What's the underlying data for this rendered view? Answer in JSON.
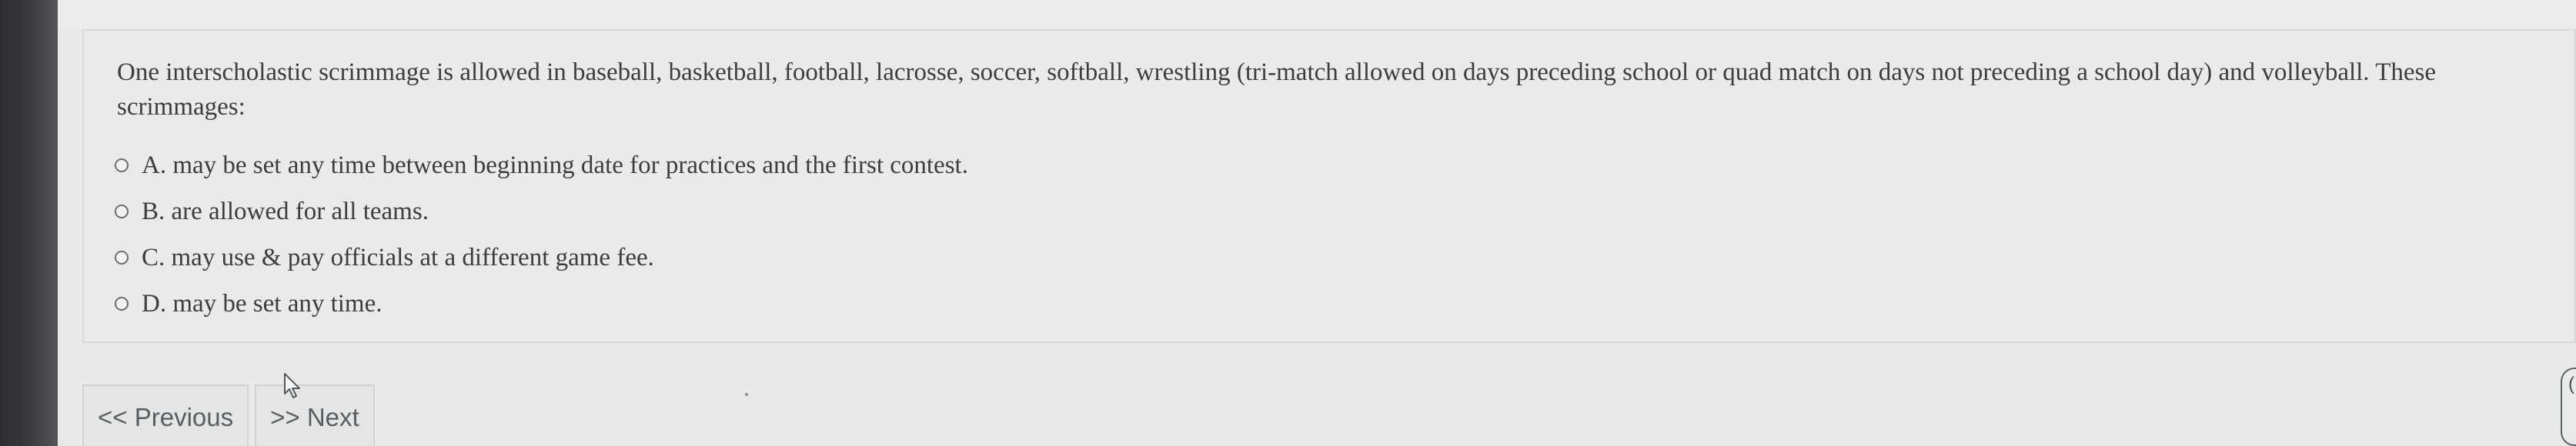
{
  "question": {
    "text": "One interscholastic scrimmage is allowed in baseball, basketball, football, lacrosse, soccer, softball, wrestling (tri-match allowed on days preceding school or quad match on days not preceding a school day) and volleyball. These scrimmages:",
    "options": [
      {
        "label": "A. may be set any time between beginning date for practices and the first contest."
      },
      {
        "label": "B. are allowed for all teams."
      },
      {
        "label": "C. may use & pay officials at a different game fee."
      },
      {
        "label": "D. may be set any time."
      }
    ]
  },
  "nav": {
    "previous_label": "<< Previous",
    "next_label": ">> Next"
  },
  "edge": {
    "glyph": "("
  },
  "icons": {
    "radio": "radio-button-icon",
    "cursor": "mouse-pointer-icon"
  },
  "colors": {
    "background": "#e8e9e9",
    "text": "#3b3d40",
    "sidebar": "#2c2d31"
  }
}
